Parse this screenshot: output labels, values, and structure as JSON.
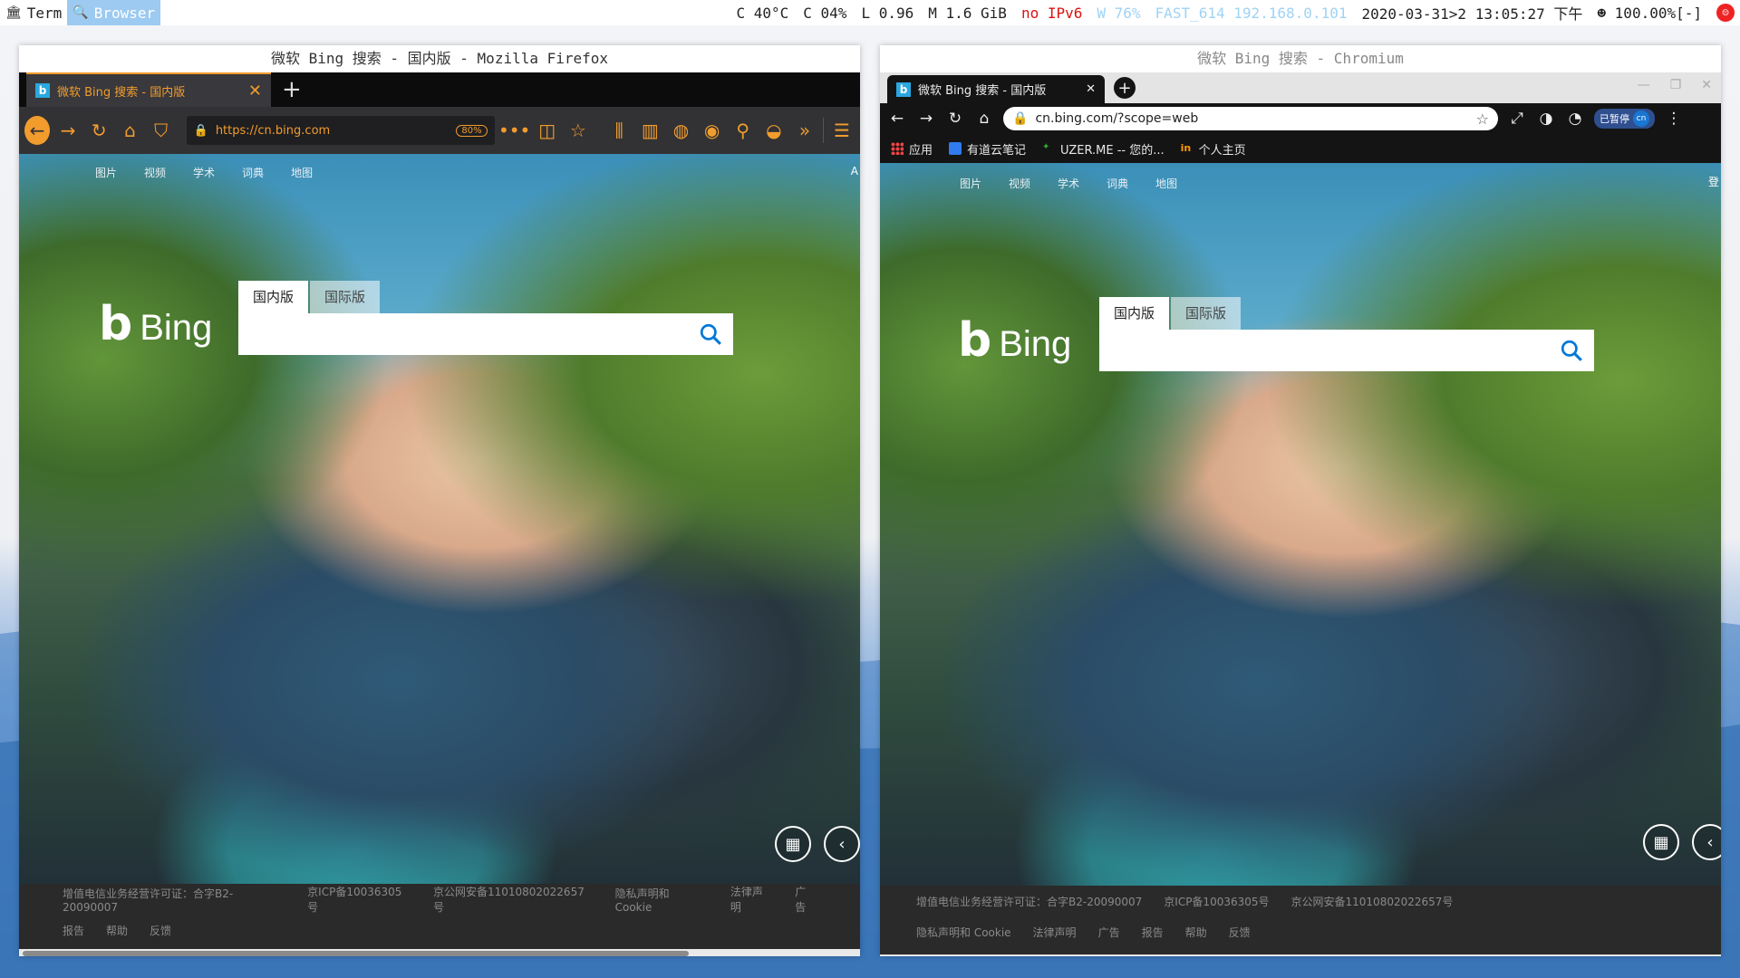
{
  "topbar": {
    "workspaces": [
      {
        "label": "Term",
        "icon": "bank-icon",
        "active": false
      },
      {
        "label": "Browser",
        "icon": "search-icon",
        "active": true
      }
    ],
    "status": {
      "cpu_temp": "C 40°C",
      "cpu_usage": "C 04%",
      "load": "L 0.96",
      "memory": "M 1.6 GiB",
      "ipv6": "no IPv6",
      "wifi": "W 76%",
      "network": "FAST_614 192.168.0.101",
      "datetime": "2020-03-31>2 13:05:27 下午",
      "volume": "☻ 100.00%[-]"
    }
  },
  "firefox": {
    "window_title": "微软 Bing 搜索 - 国内版 - Mozilla Firefox",
    "tab_label": "微软 Bing 搜索 - 国内版",
    "url": "https://cn.bing.com",
    "zoom": "80%",
    "accent_color": "#f19c2d"
  },
  "chromium": {
    "window_title": "微软 Bing 搜索 - Chromium",
    "tab_label": "微软 Bing 搜索 - 国内版",
    "url": "cn.bing.com/?scope=web",
    "paused_label": "已暂停",
    "avatar": "cn",
    "bookmarks": [
      "应用",
      "有道云笔记",
      "UZER.ME -- 您的...",
      "个人主页"
    ]
  },
  "bing": {
    "nav": [
      "图片",
      "视频",
      "学术",
      "词典",
      "地图"
    ],
    "logo_text": "Bing",
    "tabs": [
      "国内版",
      "国际版"
    ],
    "ff_corner": "A",
    "cr_corner": "登",
    "ff_footer_row1": [
      "增值电信业务经营许可证：合字B2-20090007",
      "京ICP备10036305号",
      "京公网安备11010802022657号",
      "隐私声明和 Cookie",
      "法律声明",
      "广告"
    ],
    "ff_footer_row2": [
      "报告",
      "帮助",
      "反馈"
    ],
    "cr_footer_row1": [
      "增值电信业务经营许可证：合字B2-20090007",
      "京ICP备10036305号",
      "京公网安备11010802022657号"
    ],
    "cr_footer_row2": [
      "隐私声明和 Cookie",
      "法律声明",
      "广告",
      "报告",
      "帮助",
      "反馈"
    ]
  }
}
